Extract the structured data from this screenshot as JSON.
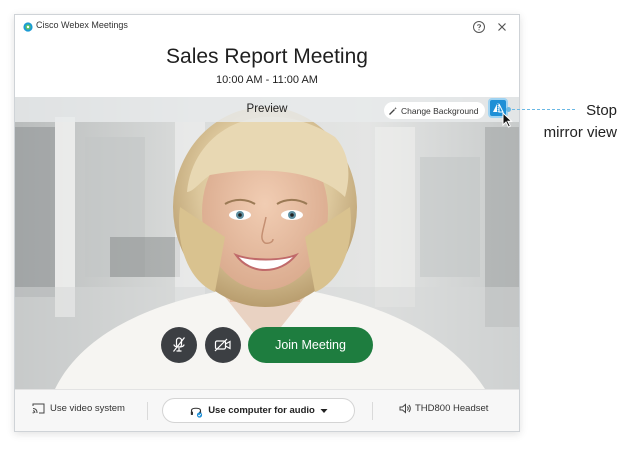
{
  "window": {
    "app_title": "Cisco Webex Meetings",
    "icons": {
      "help": "help-icon",
      "close": "close-icon",
      "logo": "webex-logo-icon"
    }
  },
  "meeting": {
    "title": "Sales Report Meeting",
    "time": "10:00 AM - 11:00 AM"
  },
  "preview": {
    "label": "Preview",
    "change_background_label": "Change Background",
    "mirror_button_icon": "mirror-view-icon"
  },
  "controls": {
    "mute_icon": "microphone-muted-icon",
    "video_icon": "video-off-icon",
    "join_label": "Join Meeting",
    "join_color": "#1e7d3f"
  },
  "bottom_bar": {
    "video_system_label": "Use video system",
    "audio_option": "Use computer for audio",
    "speaker_device": "THD800 Headset"
  },
  "annotation": {
    "line1": "Stop",
    "line2": "mirror view",
    "color": "#6ab8e4"
  },
  "colors": {
    "accent": "#1e8fd6",
    "join": "#1e7d3f",
    "control_dark": "#3c3f43"
  }
}
